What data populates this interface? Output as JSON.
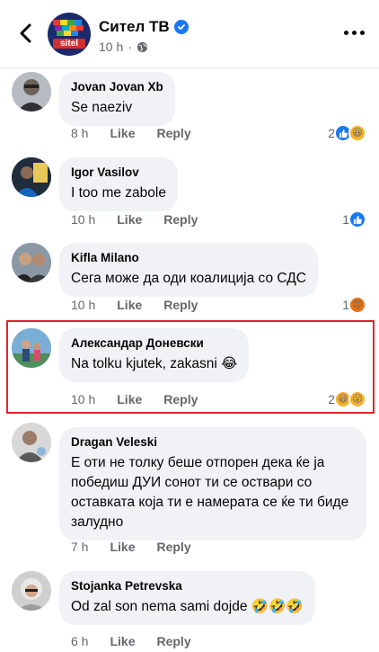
{
  "header": {
    "page_name": "Сител ТВ",
    "time": "10 h",
    "logo_text": "sitel"
  },
  "comments": [
    {
      "author": "Jovan Jovan Xb",
      "text": "Se naeziv",
      "time": "8 h",
      "like": "Like",
      "reply": "Reply",
      "reaction_count": "2",
      "reactions": [
        "like",
        "haha"
      ]
    },
    {
      "author": "Igor Vasilov",
      "text": "I too me zabole",
      "time": "10 h",
      "like": "Like",
      "reply": "Reply",
      "reaction_count": "1",
      "reactions": [
        "like"
      ]
    },
    {
      "author": "Kifla Milano",
      "text": "Сега може  да оди коалиција  со СДС",
      "time": "10 h",
      "like": "Like",
      "reply": "Reply",
      "reaction_count": "1",
      "reactions": [
        "angry"
      ]
    },
    {
      "author": "Александар Доневски",
      "text": "Na tolku kjutek, zakasni 😂",
      "time": "10 h",
      "like": "Like",
      "reply": "Reply",
      "reaction_count": "2",
      "reactions": [
        "haha",
        "wow"
      ]
    },
    {
      "author": "Dragan Veleski",
      "text": "Е оти не толку беше отпорен дека ќе ја победиш ДУИ сонот ти се оствари со оставката која ти е намерата се ќе ти биде залудно",
      "time": "7 h",
      "like": "Like",
      "reply": "Reply",
      "reaction_count": "",
      "reactions": []
    },
    {
      "author": "Stojanka Petrevska",
      "text": "Od zal son nema sami dojde 🤣🤣🤣",
      "time": "6 h",
      "like": "Like",
      "reply": "Reply",
      "reaction_count": "",
      "reactions": []
    }
  ],
  "colors": {
    "accent": "#1877f2",
    "bubble": "#f0f2f5",
    "highlight": "#e0242b",
    "meta": "#65676b"
  }
}
